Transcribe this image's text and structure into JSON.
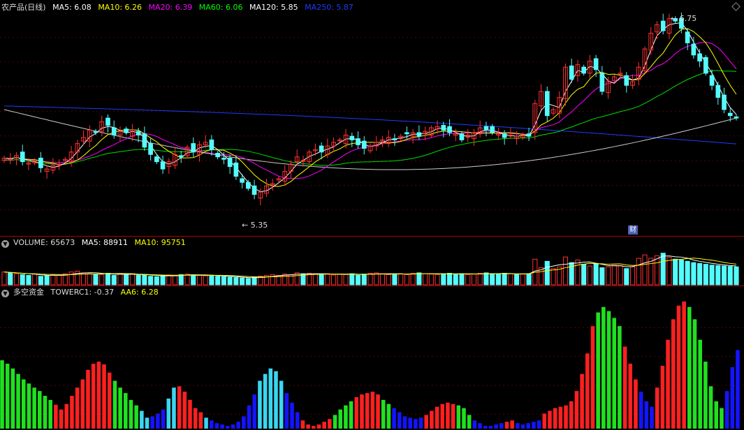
{
  "main_header": {
    "title": "农产品(日线)",
    "ma": [
      {
        "label": "MA5: 6.08",
        "color": "#ffffff"
      },
      {
        "label": "MA10: 6.26",
        "color": "#ffff00"
      },
      {
        "label": "MA20: 6.39",
        "color": "#ff00ff"
      },
      {
        "label": "MA60: 6.06",
        "color": "#00ff00"
      },
      {
        "label": "MA120: 5.85",
        "color": "#ffffff"
      },
      {
        "label": "MA250: 5.87",
        "color": "#1e3cff"
      }
    ]
  },
  "annotations": {
    "high": "6.75",
    "low": "5.35",
    "cai": "财"
  },
  "volume_header": {
    "title": "VOLUME: 65673",
    "ma5": "MA5: 88911",
    "ma10": "MA10: 95751"
  },
  "fund_header": {
    "title": "多空资金",
    "tower": "TOWERC1: -0.37",
    "aa6": "AA6: 6.28"
  },
  "colors": {
    "up": "#ff3232",
    "down": "#54fcfc",
    "bg": "#000000",
    "grid": "#8b0000"
  },
  "chart_data": [
    {
      "type": "candlestick",
      "title": "农产品(日线)",
      "ylim": [
        5.2,
        6.95
      ],
      "closes": [
        5.75,
        5.74,
        5.77,
        5.72,
        5.71,
        5.73,
        5.67,
        5.66,
        5.69,
        5.7,
        5.74,
        5.8,
        5.87,
        5.92,
        5.98,
        5.96,
        6.05,
        6.02,
        5.94,
        5.97,
        5.96,
        5.98,
        5.94,
        5.84,
        5.78,
        5.72,
        5.66,
        5.72,
        5.78,
        5.76,
        5.84,
        5.8,
        5.86,
        5.88,
        5.82,
        5.76,
        5.74,
        5.68,
        5.6,
        5.55,
        5.5,
        5.45,
        5.47,
        5.52,
        5.54,
        5.58,
        5.64,
        5.7,
        5.76,
        5.73,
        5.8,
        5.82,
        5.8,
        5.85,
        5.88,
        5.9,
        5.94,
        5.9,
        5.86,
        5.83,
        5.85,
        5.88,
        5.9,
        5.92,
        5.9,
        5.93,
        5.95,
        5.96,
        5.93,
        5.97,
        6.0,
        6.01,
        5.98,
        5.96,
        5.95,
        5.9,
        5.94,
        5.96,
        6.0,
        5.98,
        5.96,
        5.95,
        5.92,
        5.94,
        5.93,
        5.94,
        5.93,
        6.2,
        6.3,
        6.1,
        6.15,
        6.25,
        6.5,
        6.4,
        6.52,
        6.45,
        6.55,
        6.48,
        6.3,
        6.38,
        6.42,
        6.45,
        6.35,
        6.38,
        6.5,
        6.65,
        6.78,
        6.85,
        6.8,
        6.9,
        6.88,
        6.82,
        6.7,
        6.6,
        6.55,
        6.45,
        6.35,
        6.25,
        6.15,
        6.1,
        6.08
      ],
      "ma5_last": 6.08,
      "ma10_last": 6.26,
      "ma20_last": 6.39,
      "ma60_last": 6.06,
      "ma120_last": 5.85,
      "ma250_last": 5.87,
      "high_label": 6.75,
      "low_label": 5.35
    },
    {
      "type": "bar",
      "title": "VOLUME",
      "values": [
        30,
        28,
        26,
        24,
        22,
        25,
        20,
        21,
        23,
        22,
        26,
        30,
        32,
        28,
        26,
        25,
        24,
        27,
        22,
        25,
        24,
        26,
        22,
        23,
        20,
        19,
        21,
        23,
        22,
        24,
        25,
        23,
        22,
        21,
        22,
        20,
        19,
        18,
        17,
        16,
        15,
        18,
        20,
        22,
        24,
        22,
        25,
        24,
        28,
        26,
        27,
        25,
        24,
        26,
        23,
        25,
        24,
        26,
        22,
        25,
        27,
        28,
        26,
        24,
        25,
        26,
        24,
        27,
        28,
        26,
        25,
        24,
        26,
        27,
        25,
        26,
        24,
        25,
        27,
        28,
        26,
        25,
        27,
        26,
        24,
        25,
        26,
        60,
        40,
        55,
        38,
        42,
        65,
        52,
        58,
        48,
        44,
        50,
        40,
        42,
        46,
        45,
        38,
        42,
        62,
        70,
        62,
        68,
        74,
        64,
        60,
        58,
        55,
        52,
        50,
        48,
        46,
        45,
        44,
        43,
        42
      ],
      "ma5_last": 88911,
      "ma10_last": 95751,
      "last": 65673
    },
    {
      "type": "bar",
      "title": "多空资金",
      "values": [
        100,
        95,
        88,
        80,
        72,
        66,
        60,
        55,
        48,
        42,
        35,
        28,
        36,
        48,
        60,
        72,
        86,
        95,
        98,
        94,
        82,
        70,
        60,
        52,
        42,
        34,
        26,
        16,
        18,
        22,
        28,
        44,
        60,
        62,
        54,
        42,
        30,
        24,
        16,
        12,
        8,
        6,
        4,
        6,
        10,
        18,
        34,
        50,
        70,
        80,
        88,
        84,
        70,
        52,
        38,
        24,
        12,
        6,
        4,
        6,
        10,
        14,
        20,
        28,
        34,
        40,
        46,
        50,
        52,
        54,
        50,
        42,
        36,
        30,
        24,
        18,
        16,
        14,
        16,
        20,
        26,
        32,
        36,
        38,
        36,
        34,
        30,
        20,
        12,
        8,
        4,
        4,
        6,
        8,
        10,
        12,
        8,
        6,
        8,
        10,
        12,
        22,
        26,
        30,
        32,
        34,
        40,
        55,
        80,
        110,
        150,
        170,
        178,
        172,
        162,
        150,
        120,
        95,
        72,
        54,
        40,
        32,
        60,
        92,
        130,
        160,
        180,
        186,
        178,
        160,
        130,
        98,
        62,
        40,
        30,
        55,
        90,
        115
      ],
      "colors_seq": [
        "g",
        "g",
        "g",
        "g",
        "g",
        "g",
        "g",
        "g",
        "g",
        "g",
        "r",
        "r",
        "r",
        "r",
        "r",
        "r",
        "r",
        "r",
        "r",
        "r",
        "r",
        "g",
        "g",
        "g",
        "g",
        "g",
        "c",
        "c",
        "b",
        "b",
        "b",
        "c",
        "c",
        "r",
        "r",
        "r",
        "r",
        "r",
        "c",
        "b",
        "b",
        "b",
        "b",
        "b",
        "b",
        "b",
        "b",
        "b",
        "c",
        "c",
        "c",
        "c",
        "c",
        "b",
        "b",
        "b",
        "r",
        "r",
        "r",
        "r",
        "r",
        "r",
        "g",
        "g",
        "g",
        "g",
        "r",
        "r",
        "r",
        "r",
        "r",
        "g",
        "g",
        "b",
        "b",
        "b",
        "b",
        "b",
        "b",
        "r",
        "r",
        "r",
        "r",
        "r",
        "r",
        "g",
        "g",
        "g",
        "b",
        "b",
        "b",
        "b",
        "b",
        "b",
        "r",
        "r",
        "b",
        "b",
        "b",
        "b",
        "b",
        "r",
        "r",
        "r",
        "r",
        "r",
        "r",
        "r",
        "r",
        "r",
        "r",
        "g",
        "g",
        "g",
        "g",
        "g",
        "r",
        "r",
        "r",
        "b",
        "b",
        "b",
        "r",
        "r",
        "r",
        "r",
        "r",
        "r",
        "g",
        "g",
        "g",
        "g",
        "g",
        "g",
        "g",
        "b",
        "b",
        "b",
        "b",
        "b",
        "b"
      ],
      "tower_last": -0.37,
      "aa6_last": 6.28
    }
  ]
}
